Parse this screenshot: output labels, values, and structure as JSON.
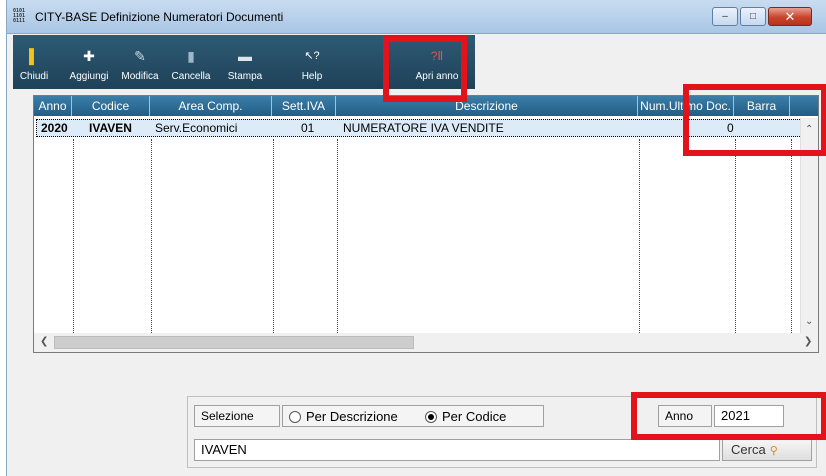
{
  "window": {
    "title": "CITY-BASE Definizione Numeratori Documenti",
    "icon_text": "0101\n1101\n0111",
    "minimize": "–",
    "maximize": "□",
    "close": "✕"
  },
  "toolbar": {
    "buttons": [
      {
        "label": "Chiudi",
        "icon": "exit-door-icon",
        "glyph": "▌"
      },
      {
        "label": "Aggiungi",
        "icon": "plus-icon",
        "glyph": "✚"
      },
      {
        "label": "Modifica",
        "icon": "pencil-icon",
        "glyph": "✎"
      },
      {
        "label": "Cancella",
        "icon": "trash-icon",
        "glyph": "▮"
      },
      {
        "label": "Stampa",
        "icon": "printer-icon",
        "glyph": "▬"
      },
      {
        "label": "Help",
        "icon": "help-cursor-icon",
        "glyph": "↖?"
      },
      {
        "label": "Apri anno",
        "icon": "calendar-icon",
        "glyph": "?Ⅱ"
      }
    ]
  },
  "grid": {
    "columns": [
      "Anno",
      "Codice",
      "Area Comp.",
      "Sett.IVA",
      "Descrizione",
      "Num.Ultimo Doc.",
      "Barra"
    ],
    "rows": [
      {
        "anno": "2020",
        "codice": "IVAVEN",
        "area": "Serv.Economici",
        "sett_iva": "01",
        "descrizione": "NUMERATORE IVA VENDITE",
        "num_ultimo": "0",
        "barra": ""
      }
    ]
  },
  "filter": {
    "selezione_label": "Selezione",
    "radio_descrizione": "Per Descrizione",
    "radio_codice": "Per Codice",
    "selected": "Per Codice",
    "anno_label": "Anno",
    "anno_value": "2021",
    "search_value": "IVAVEN",
    "cerca_label": "Cerca"
  },
  "colors": {
    "toolbar_bg": "#1e4258",
    "header_bg": "#215d86",
    "selected_row": "#dcebf7",
    "highlight": "#e3131b"
  }
}
